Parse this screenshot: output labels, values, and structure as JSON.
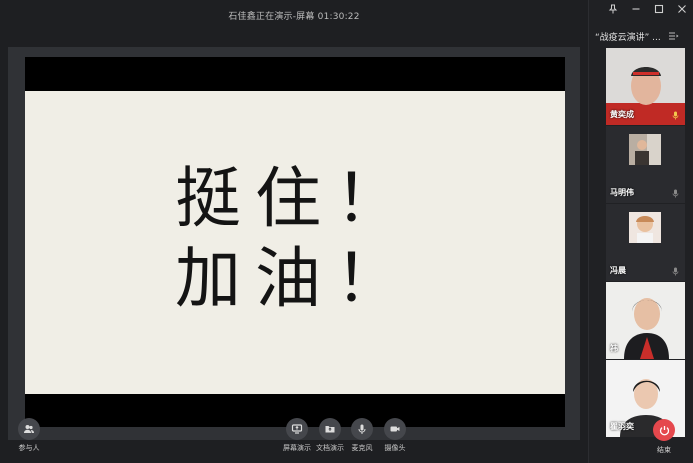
{
  "window": {
    "title": "石佳鑫正在演示-屏幕 01:30:22"
  },
  "slide": {
    "line1": "挺住！",
    "line2": "加油！"
  },
  "toolbar": {
    "participants_label": "参与人",
    "screen_share_label": "屏幕演示",
    "doc_share_label": "文档演示",
    "mic_label": "麦克风",
    "camera_label": "摄像头",
    "end_label": "结束"
  },
  "sidebar": {
    "meeting_title": "“战疫云演讲” ...",
    "participants": [
      {
        "name": "黄奕成"
      },
      {
        "name": "马明伟"
      },
      {
        "name": "冯晨"
      },
      {
        "name": "祎"
      },
      {
        "name": "瞿羽奕"
      }
    ]
  },
  "colors": {
    "background": "#1f2023",
    "slide_paper": "#f0eee6",
    "end_button": "#e5484d",
    "toolbar_icon_bg": "#45474c"
  }
}
